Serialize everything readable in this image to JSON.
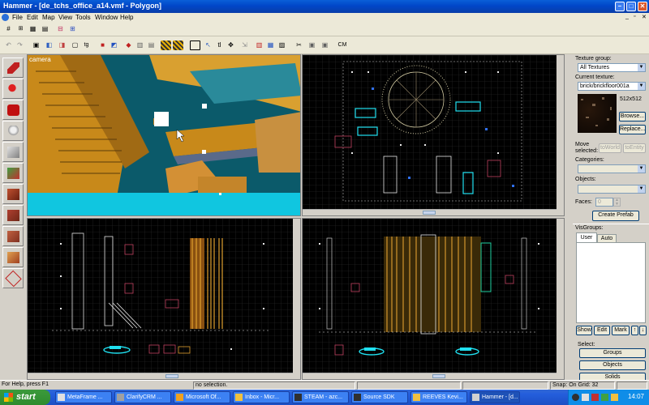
{
  "window": {
    "title": "Hammer - [de_tchs_office_a14.vmf - Polygon]"
  },
  "menu": [
    "File",
    "Edit",
    "Map",
    "View",
    "Tools",
    "Window",
    "Help"
  ],
  "toolbar2": {
    "cm_label": "CM"
  },
  "toolbox": [
    "selection-tool",
    "magnify-tool",
    "camera-tool",
    "entity-tool",
    "block-tool",
    "texture-application-tool",
    "apply-current-texture-tool",
    "decal-tool",
    "overlay-tool",
    "clipping-tool",
    "vertex-tool"
  ],
  "viewports": {
    "camera_label": "camera"
  },
  "right_panel": {
    "texture_group_label": "Texture group:",
    "texture_group_value": "All Textures",
    "current_texture_label": "Current texture:",
    "current_texture_value": "brick/brickfloor001a",
    "texture_size": "512x512",
    "browse_label": "Browse...",
    "replace_label": "Replace...",
    "move_selected_label": "Move selected:",
    "toworld_label": "toWorld",
    "toentity_label": "toEntity",
    "categories_label": "Categories:",
    "objects_label": "Objects:",
    "faces_label": "Faces:",
    "faces_value": "0",
    "create_prefab_label": "Create Prefab",
    "visgroups_label": "VisGroups:",
    "tab_user": "User",
    "tab_auto": "Auto",
    "show_label": "Show",
    "edit_label": "Edit",
    "mark_label": "Mark",
    "select_label": "Select:",
    "groups_label": "Groups",
    "objects_btn_label": "Objects",
    "solids_label": "Solids"
  },
  "status": {
    "help": "For Help, press F1",
    "selection": "no selection.",
    "snap": "Snap: On Grid: 32"
  },
  "taskbar": {
    "start": "start",
    "items": [
      "MetaFrame ...",
      "ClarifyCRM ...",
      "Microsoft Of...",
      "Inbox - Micr...",
      "STEAM - azc...",
      "Source SDK",
      "REEVES Kevi...",
      "Hammer - [d..."
    ],
    "clock": "14:07"
  },
  "colors": {
    "title_bar": "#0a5fd8",
    "viewport_bg": "#000000",
    "grid": "#3a3a3a",
    "orange_brush": "#e0a030",
    "cyan_entity": "#20e0f0",
    "taskbar": "#245edc",
    "start_button": "#3c9a3c"
  }
}
